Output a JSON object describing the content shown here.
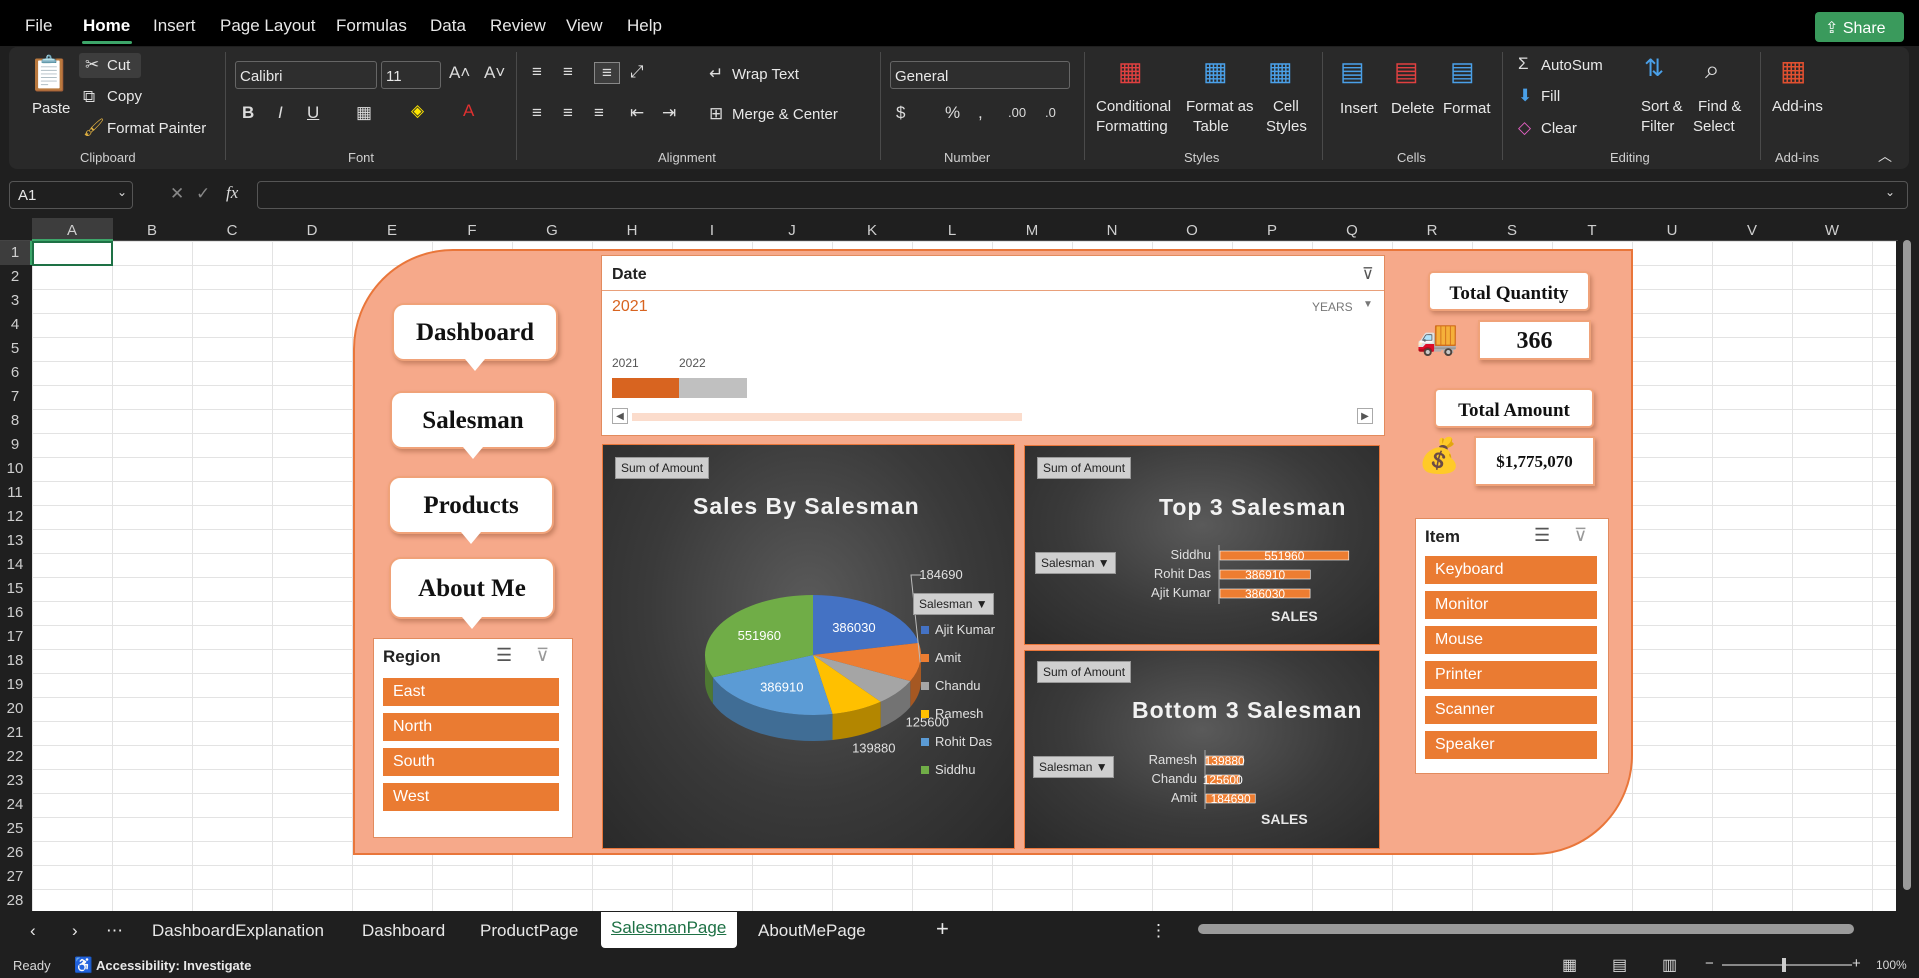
{
  "menu": {
    "file": "File",
    "home": "Home",
    "insert": "Insert",
    "page_layout": "Page Layout",
    "formulas": "Formulas",
    "data": "Data",
    "review": "Review",
    "view": "View",
    "help": "Help",
    "share": "Share"
  },
  "ribbon": {
    "paste": "Paste",
    "cut": "Cut",
    "copy": "Copy",
    "format_painter": "Format Painter",
    "clipboard": "Clipboard",
    "font_name": "Calibri",
    "font_size": "11",
    "font": "Font",
    "wrap_text": "Wrap Text",
    "merge_center": "Merge & Center",
    "alignment": "Alignment",
    "number_format": "General",
    "number": "Number",
    "cond_fmt_1": "Conditional",
    "cond_fmt_2": "Formatting",
    "fmt_table_1": "Format as",
    "fmt_table_2": "Table",
    "cell_styles_1": "Cell",
    "cell_styles_2": "Styles",
    "styles": "Styles",
    "insert": "Insert",
    "delete": "Delete",
    "format": "Format",
    "cells": "Cells",
    "autosum": "AutoSum",
    "fill": "Fill",
    "clear": "Clear",
    "sort_1": "Sort &",
    "sort_2": "Filter",
    "find_1": "Find &",
    "find_2": "Select",
    "editing": "Editing",
    "addins": "Add-ins",
    "addins_group": "Add-ins"
  },
  "formula_bar": {
    "name_box": "A1",
    "fx": "fx",
    "value": ""
  },
  "columns": [
    "A",
    "B",
    "C",
    "D",
    "E",
    "F",
    "G",
    "H",
    "I",
    "J",
    "K",
    "L",
    "M",
    "N",
    "O",
    "P",
    "Q",
    "R",
    "S",
    "T",
    "U",
    "V",
    "W"
  ],
  "rows": [
    "1",
    "2",
    "3",
    "4",
    "5",
    "6",
    "7",
    "8",
    "9",
    "10",
    "11",
    "12",
    "13",
    "14",
    "15",
    "16",
    "17",
    "18",
    "19",
    "20",
    "21",
    "22",
    "23",
    "24",
    "25",
    "26",
    "27",
    "28"
  ],
  "nav": [
    "Dashboard",
    "Salesman",
    "Products",
    "About Me"
  ],
  "region_slicer": {
    "title": "Region",
    "items": [
      "East",
      "North",
      "South",
      "West"
    ]
  },
  "item_slicer": {
    "title": "Item",
    "items": [
      "Keyboard",
      "Monitor",
      "Mouse",
      "Printer",
      "Scanner",
      "Speaker"
    ]
  },
  "timeline": {
    "title": "Date",
    "selected": "2021",
    "level": "YEARS",
    "years": [
      "2021",
      "2022"
    ]
  },
  "kpi": {
    "qty_label": "Total Quantity",
    "qty_value": "366",
    "amt_label": "Total Amount",
    "amt_value": "$1,775,070"
  },
  "pie_chart": {
    "tag": "Sum of Amount",
    "filter_label": "Salesman",
    "chart_data": {
      "type": "pie",
      "title": "Sales By Salesman",
      "labels": [
        "Ajit Kumar",
        "Amit",
        "Chandu",
        "Ramesh",
        "Rohit Das",
        "Siddhu"
      ],
      "values": [
        386030,
        184690,
        125600,
        139880,
        386910,
        551960
      ],
      "colors": [
        "#4472c4",
        "#ed7d31",
        "#a5a5a5",
        "#ffc000",
        "#5b9bd5",
        "#70ad47"
      ],
      "legend": "right"
    }
  },
  "top3_chart": {
    "tag": "Sum of Amount",
    "filter_label": "Salesman",
    "chart_data": {
      "type": "bar",
      "title": "Top 3 Salesman",
      "xlabel": "SALES",
      "categories": [
        "Siddhu",
        "Rohit Das",
        "Ajit Kumar"
      ],
      "values": [
        551960,
        386910,
        386030
      ]
    }
  },
  "bottom3_chart": {
    "tag": "Sum of Amount",
    "filter_label": "Salesman",
    "chart_data": {
      "type": "bar",
      "title": "Bottom 3 Salesman",
      "xlabel": "SALES",
      "categories": [
        "Ramesh",
        "Chandu",
        "Amit"
      ],
      "values": [
        139880,
        125600,
        184690
      ]
    }
  },
  "sheets": [
    "DashboardExplanation",
    "Dashboard",
    "ProductPage",
    "SalesmanPage",
    "AboutMePage"
  ],
  "active_sheet": "SalesmanPage",
  "status": {
    "ready": "Ready",
    "accessibility": "Accessibility: Investigate",
    "zoom": "100%"
  }
}
